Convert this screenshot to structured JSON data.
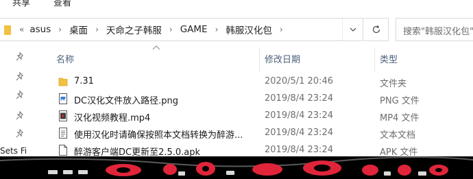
{
  "ribbon": {
    "tab_view_label": "共享",
    "tab_share_label": "查看"
  },
  "address": {
    "crumbs": [
      "asus",
      "桌面",
      "天命之子韩服",
      "GAME",
      "韩服汉化包"
    ]
  },
  "search": {
    "placeholder": "搜索\"韩服汉化包\""
  },
  "columns": {
    "name": "名称",
    "date": "修改日期",
    "type": "类型"
  },
  "files": [
    {
      "name": "7.31",
      "date": "2020/5/1 20:46",
      "type": "文件夹",
      "icon": "folder-icon"
    },
    {
      "name": "DC汉化文件放入路径.png",
      "date": "2019/8/4 23:24",
      "type": "PNG 文件",
      "icon": "image-file-icon"
    },
    {
      "name": "汉化视频教程.mp4",
      "date": "2019/8/4 23:24",
      "type": "MP4 文件",
      "icon": "video-file-icon"
    },
    {
      "name": "使用汉化时请确保按照本文档转换为醉游...",
      "date": "2019/8/4 23:24",
      "type": "文本文档",
      "icon": "text-file-icon"
    },
    {
      "name": "醉游客户端DC更新至2.5.0.apk",
      "date": "2019/8/4 23:24",
      "type": "APK 文件",
      "icon": "apk-file-icon"
    }
  ],
  "nav": {
    "clipped_label": "Sets Fi"
  },
  "colors": {
    "folder": "#f4c042",
    "header_text": "#4c607a",
    "meta_text": "#6d6d6d",
    "banner": "#000000",
    "banner_accent": "#e0253a"
  }
}
